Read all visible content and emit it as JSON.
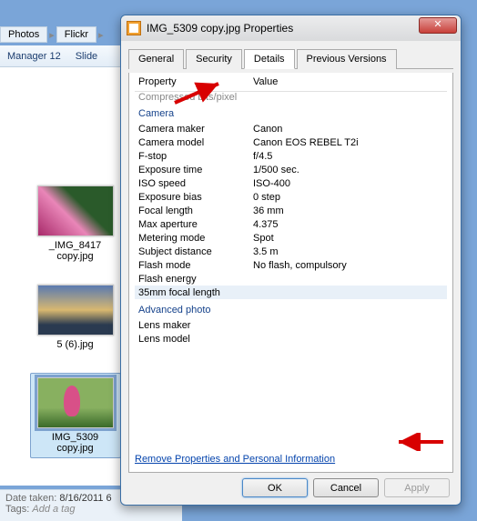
{
  "breadcrumb": {
    "items": [
      "Photos",
      "Flickr"
    ]
  },
  "toolbar": {
    "items": [
      "Manager 12",
      "Slide"
    ]
  },
  "thumbs": [
    {
      "label": "_IMG_8417 copy.jpg",
      "cls": "flower"
    },
    {
      "label": "5 (6).jpg",
      "cls": "skyline"
    },
    {
      "label": "IMG_5309 copy.jpg",
      "cls": "park",
      "selected": true
    }
  ],
  "details_pane": {
    "date_label": "Date taken:",
    "date_value": "8/16/2011 6",
    "tags_label": "Tags:",
    "tags_value": "Add a tag"
  },
  "dialog": {
    "title": "IMG_5309 copy.jpg Properties",
    "tabs": [
      "General",
      "Security",
      "Details",
      "Previous Versions"
    ],
    "active_tab": 2,
    "header": {
      "property": "Property",
      "value": "Value"
    },
    "cut_row": "Compressed bits/pixel",
    "sections": [
      {
        "title": "Camera",
        "rows": [
          {
            "p": "Camera maker",
            "v": "Canon"
          },
          {
            "p": "Camera model",
            "v": "Canon EOS REBEL T2i"
          },
          {
            "p": "F-stop",
            "v": "f/4.5"
          },
          {
            "p": "Exposure time",
            "v": "1/500 sec."
          },
          {
            "p": "ISO speed",
            "v": "ISO-400"
          },
          {
            "p": "Exposure bias",
            "v": "0 step"
          },
          {
            "p": "Focal length",
            "v": "36 mm"
          },
          {
            "p": "Max aperture",
            "v": "4.375"
          },
          {
            "p": "Metering mode",
            "v": "Spot"
          },
          {
            "p": "Subject distance",
            "v": "3.5 m"
          },
          {
            "p": "Flash mode",
            "v": "No flash, compulsory"
          },
          {
            "p": "Flash energy",
            "v": ""
          },
          {
            "p": "35mm focal length",
            "v": "",
            "hl": true
          }
        ]
      },
      {
        "title": "Advanced photo",
        "rows": [
          {
            "p": "Lens maker",
            "v": ""
          },
          {
            "p": "Lens model",
            "v": ""
          }
        ]
      }
    ],
    "remove_link": "Remove Properties and Personal Information",
    "buttons": {
      "ok": "OK",
      "cancel": "Cancel",
      "apply": "Apply"
    }
  }
}
